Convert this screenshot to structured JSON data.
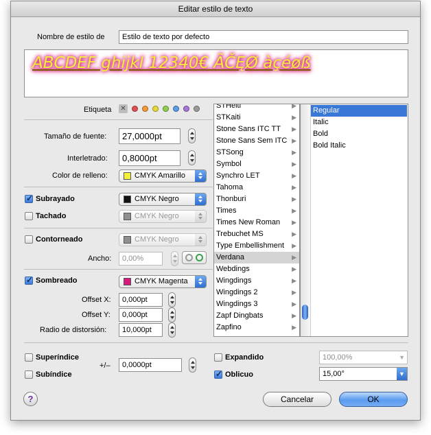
{
  "window": {
    "title": "Editar estilo de texto"
  },
  "style_name": {
    "label": "Nombre de estilo de",
    "value": "Estilo de texto por defecto"
  },
  "preview": {
    "text": "ABCDEF ghijkl 12340€ ÃČĘØ àçéøß"
  },
  "etiqueta": {
    "label": "Etiqueta",
    "colors": [
      "#e05050",
      "#f29a3a",
      "#e8d93a",
      "#8fd052",
      "#5b9be8",
      "#a576d6",
      "#9b9b9b"
    ]
  },
  "font_size": {
    "label": "Tamaño de fuente:",
    "value": "27,0000pt"
  },
  "spacing": {
    "label": "Interletrado:",
    "value": "0,8000pt"
  },
  "fill": {
    "label": "Color de relleno:",
    "value": "CMYK Amarillo",
    "swatch": "#f5f03a"
  },
  "underline": {
    "label": "Subrayado",
    "checked": true,
    "color": "CMYK Negro",
    "swatch": "#111111"
  },
  "strike": {
    "label": "Tachado",
    "checked": false,
    "color": "CMYK Negro",
    "swatch": "#8f8f8f"
  },
  "outline": {
    "label": "Contorneado",
    "checked": false,
    "color": "CMYK Negro",
    "swatch": "#8f8f8f",
    "width_label": "Ancho:",
    "width_value": "0,00%"
  },
  "shadow": {
    "label": "Sombreado",
    "checked": true,
    "color": "CMYK Magenta",
    "swatch": "#d81b7a",
    "offset_x_label": "Offset X:",
    "offset_x": "0,000pt",
    "offset_y_label": "Offset Y:",
    "offset_y": "0,000pt",
    "blur_label": "Radio de distorsión:",
    "blur": "10,000pt"
  },
  "fonts": [
    "STHeiti",
    "STKaiti",
    "Stone Sans ITC TT",
    "Stone Sans Sem ITC",
    "STSong",
    "Symbol",
    "Synchro LET",
    "Tahoma",
    "Thonburi",
    "Times",
    "Times New Roman",
    "Trebuchet MS",
    "Type Embellishment",
    "Verdana",
    "Webdings",
    "Wingdings",
    "Wingdings 2",
    "Wingdings 3",
    "Zapf Dingbats",
    "Zapfino"
  ],
  "selected_font": "Verdana",
  "styles": [
    "Regular",
    "Italic",
    "Bold",
    "Bold Italic"
  ],
  "selected_style": "Regular",
  "superscript": {
    "label": "Superíndice",
    "checked": false
  },
  "subscript": {
    "label": "Subíndice",
    "checked": false
  },
  "baseline": {
    "label": "+/–",
    "value": "0,0000pt"
  },
  "expanded": {
    "label": "Expandido",
    "checked": false,
    "value": "100,00%"
  },
  "oblique": {
    "label": "Oblicuo",
    "checked": true,
    "value": "15,00°"
  },
  "buttons": {
    "help": "?",
    "cancel": "Cancelar",
    "ok": "OK"
  }
}
